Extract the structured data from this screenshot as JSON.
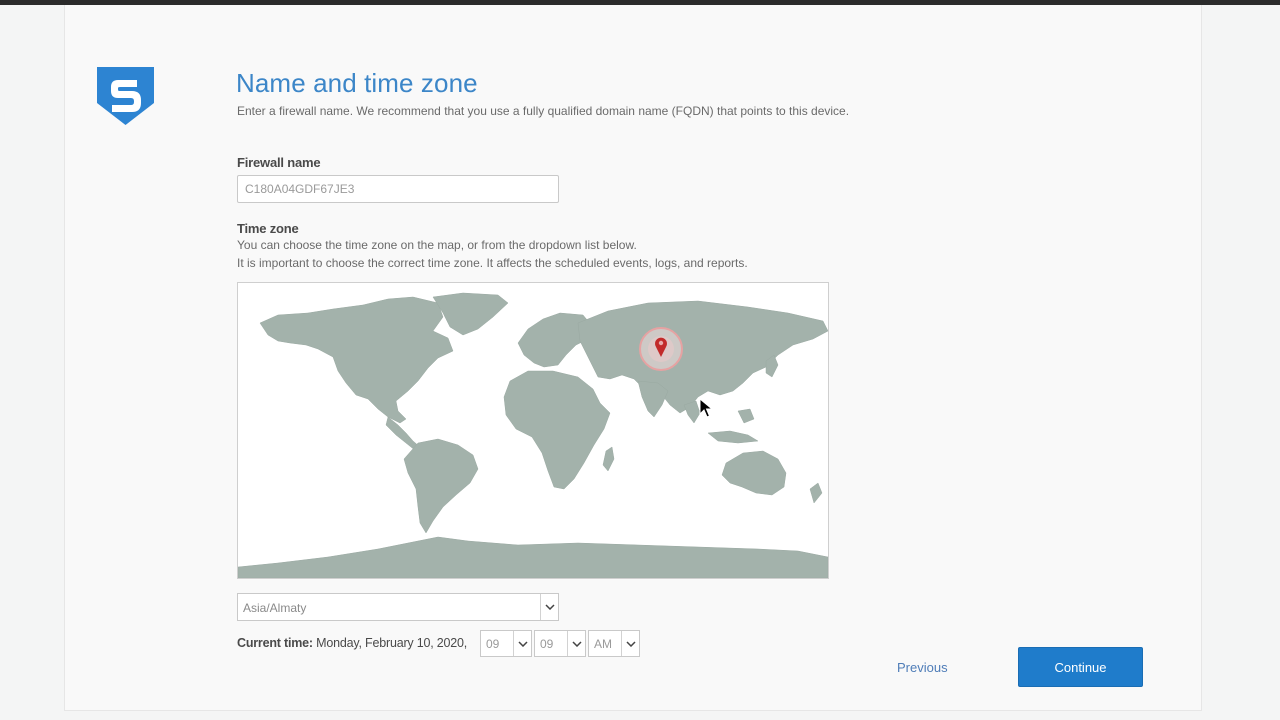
{
  "page": {
    "title": "Name and time zone",
    "subtitle": "Enter a firewall name. We recommend that you use a fully qualified domain name (FQDN) that points to this device."
  },
  "firewall": {
    "label": "Firewall name",
    "value": "C180A04GDF67JE3"
  },
  "timezone": {
    "label": "Time zone",
    "help_line1": "You can choose the time zone on the map, or from the dropdown list below.",
    "help_line2": "It is important to choose the correct time zone. It affects the scheduled events, logs, and reports.",
    "selected": "Asia/Almaty"
  },
  "current_time": {
    "label": "Current time:",
    "date": "Monday, February 10, 2020,",
    "hour": "09",
    "minute": "09",
    "ampm": "AM"
  },
  "navigation": {
    "previous_label": "Previous",
    "continue_label": "Continue"
  },
  "colors": {
    "accent": "#3c86c8",
    "button": "#1f7ccb",
    "map_land": "#a3b2ab",
    "pin": "#c22a2a"
  },
  "icons": {
    "logo": "sophos-shield-icon",
    "marker": "map-pin-icon",
    "dropdown": "chevron-down-icon",
    "cursor": "mouse-pointer-icon"
  }
}
